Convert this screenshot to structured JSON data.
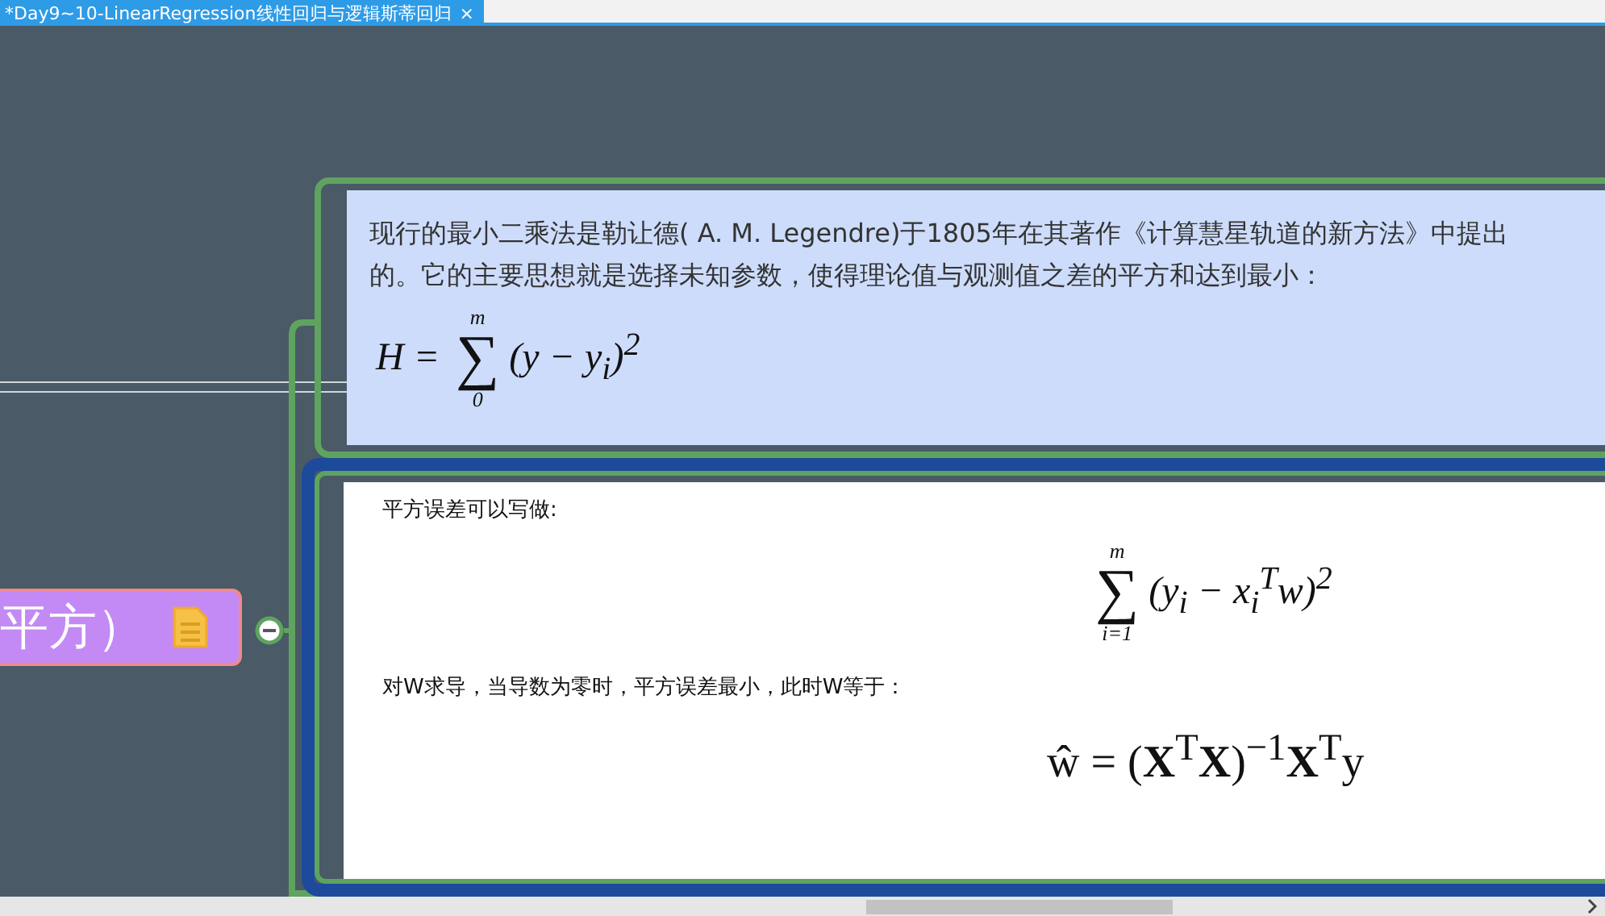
{
  "tab": {
    "title": "*Day9~10-LinearRegression线性回归与逻辑斯蒂回归",
    "close": "×"
  },
  "node": {
    "text": "平方）",
    "expanded": true
  },
  "cards": [
    {
      "kind": "highlight",
      "selected": false,
      "blocks": [
        {
          "kind": "text",
          "text": "现行的最小二乘法是勒让德( A. M. Legendre)于1805年在其著作《计算慧星轨道的新方法》中提出的。它的主要思想就是选择未知参数，使得理论值与观测值之差的平方和达到最小："
        },
        {
          "kind": "sum",
          "lhs": "H =",
          "sign": "∑",
          "upper": "m",
          "lower": "0",
          "body": "(y − y$_{i}$)$^{2}$"
        }
      ]
    },
    {
      "kind": "plain",
      "selected": true,
      "blocks": [
        {
          "kind": "text",
          "text": "平方误差可以写做:"
        },
        {
          "kind": "sum",
          "sign": "∑",
          "upper": "m",
          "lower": "i=1",
          "body": "(y$_{i}$ − x$_{i}$$^{T}$w)$^{2}$"
        },
        {
          "kind": "text",
          "text": "对W求导，当导数为零时，平方误差最小，此时W等于："
        },
        {
          "kind": "eq",
          "text": "ŵ = (**X**$^{T}$**X**)$^{−1}$**X**$^{T}$y"
        }
      ]
    }
  ]
}
